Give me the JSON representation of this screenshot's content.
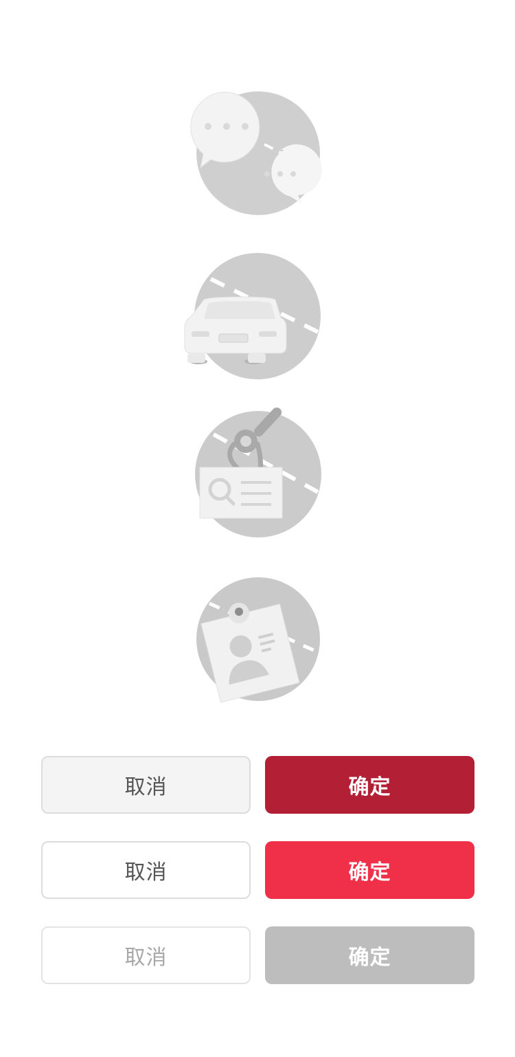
{
  "illustrations": [
    {
      "icon": "chat-bubbles-icon"
    },
    {
      "icon": "car-icon"
    },
    {
      "icon": "search-card-icon"
    },
    {
      "icon": "id-card-icon"
    }
  ],
  "buttons": {
    "row1": {
      "cancel": "取消",
      "confirm": "确定",
      "confirm_color": "#b31f35"
    },
    "row2": {
      "cancel": "取消",
      "confirm": "确定",
      "confirm_color": "#f03049"
    },
    "row3": {
      "cancel": "取消",
      "confirm": "确定",
      "confirm_color": "#bdbdbd",
      "disabled": true
    }
  }
}
